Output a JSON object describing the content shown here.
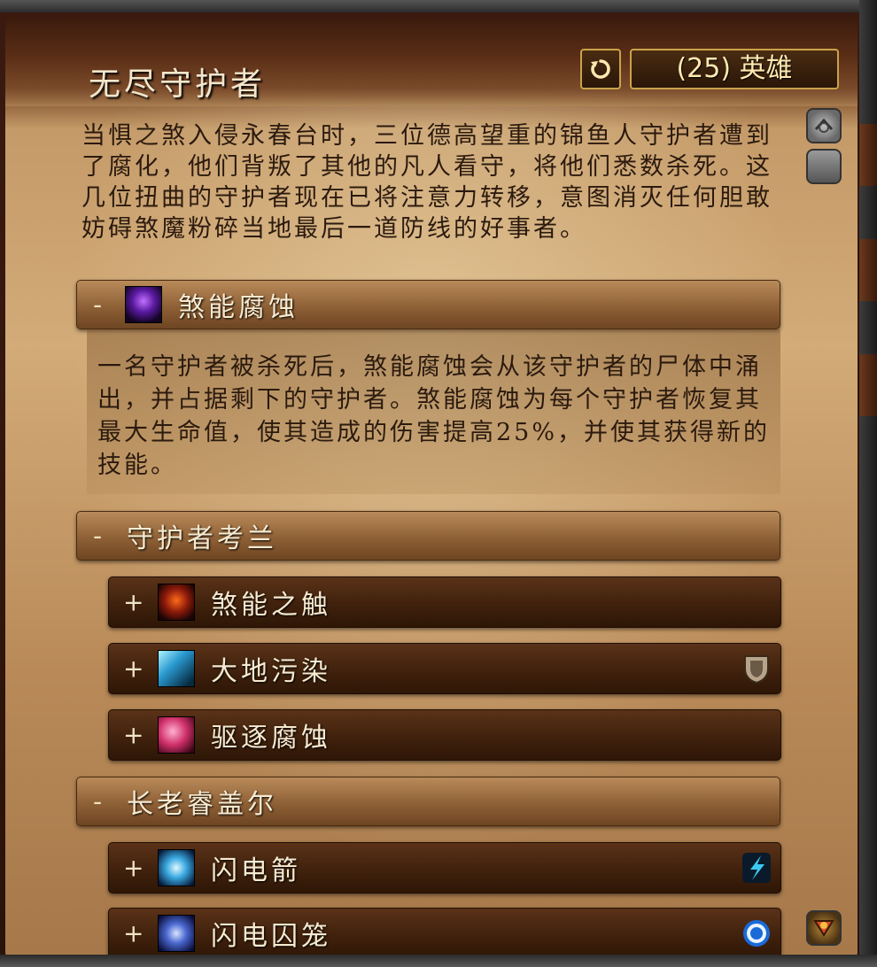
{
  "window": {
    "title": "无尽守护者",
    "difficulty_label": "(25) 英雄"
  },
  "description": "当惧之煞入侵永春台时，三位德高望重的锦鱼人守护者遭到了腐化，他们背叛了其他的凡人看守，将他们悉数杀死。这几位扭曲的守护者现在已将注意力转移，意图消灭任何胆敢妨碍煞魔粉碎当地最后一道防线的好事者。",
  "sections": [
    {
      "toggle": "-",
      "label": "煞能腐蚀",
      "icon": "sha-corruption-icon",
      "text": "一名守护者被杀死后，煞能腐蚀会从该守护者的尸体中涌出，并占据剩下的守护者。煞能腐蚀为每个守护者恢复其最大生命值，使其造成的伤害提高25%，并使其获得新的技能。"
    },
    {
      "toggle": "-",
      "label": "守护者考兰",
      "abilities": [
        {
          "toggle": "+",
          "label": "煞能之触",
          "icon": "touch-of-sha-icon"
        },
        {
          "toggle": "+",
          "label": "大地污染",
          "icon": "defiled-ground-icon",
          "flag": "tank-shield-icon"
        },
        {
          "toggle": "+",
          "label": "驱逐腐蚀",
          "icon": "expel-corruption-icon"
        }
      ]
    },
    {
      "toggle": "-",
      "label": "长老睿盖尔",
      "abilities": [
        {
          "toggle": "+",
          "label": "闪电箭",
          "icon": "lightning-bolt-icon",
          "flag": "interrupt-icon"
        },
        {
          "toggle": "+",
          "label": "闪电囚笼",
          "icon": "lightning-prison-icon",
          "flag": "magic-effect-icon"
        }
      ]
    }
  ]
}
